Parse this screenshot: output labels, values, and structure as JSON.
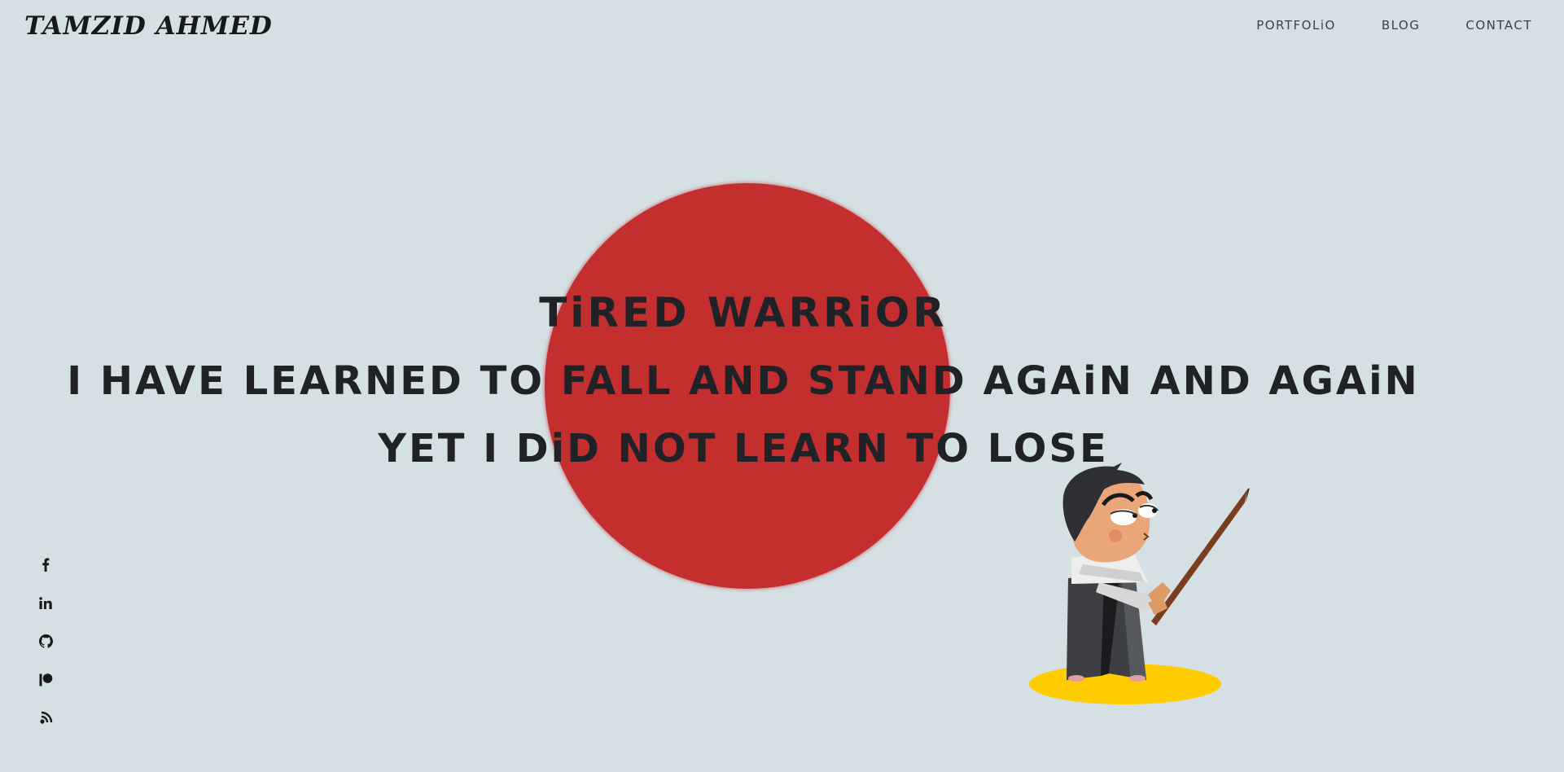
{
  "header": {
    "logo": "TAMZID AHMED",
    "nav": [
      {
        "label": "PORTFOLiO"
      },
      {
        "label": "BLOG"
      },
      {
        "label": "CONTACT"
      }
    ]
  },
  "hero": {
    "title": "TiRED WARRiOR",
    "line1": "I HAVE LEARNED TO FALL AND STAND AGAiN AND AGAiN",
    "line2": "YET I DiD NOT LEARN TO LOSE"
  },
  "social": [
    {
      "icon": "facebook-icon"
    },
    {
      "icon": "linkedin-icon"
    },
    {
      "icon": "github-icon"
    },
    {
      "icon": "patreon-icon"
    },
    {
      "icon": "blog-feed-icon"
    }
  ],
  "colors": {
    "background": "#d5e0e4",
    "sun": "#c32e2f",
    "text": "#1f2227",
    "nav_text": "#3c4148",
    "ground": "#ffcc00"
  }
}
